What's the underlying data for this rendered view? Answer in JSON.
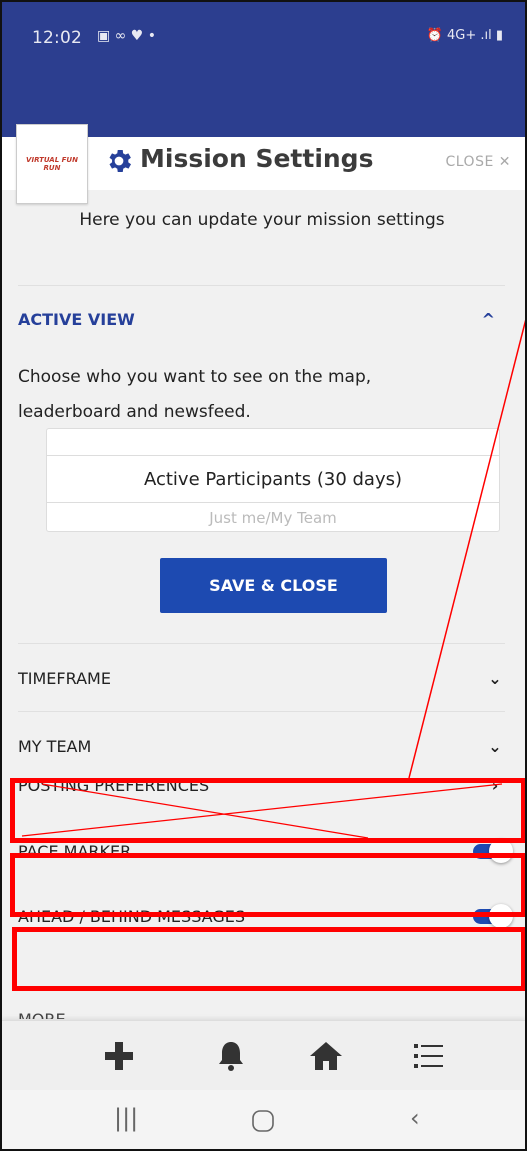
{
  "status_bar": {
    "time": "12:02",
    "left_icons": "▣ ∞ ♥ •",
    "right_icons": "⏰ 4G+ .ıl ▮"
  },
  "logo": {
    "text": "VIRTUAL FUN RUN"
  },
  "modal": {
    "title": "Mission Settings",
    "close_label": "CLOSE ✕",
    "intro": "Here you can update your mission settings"
  },
  "active_view": {
    "title": "ACTIVE VIEW",
    "description": "Choose who you want to see on the map, leaderboard and newsfeed.",
    "options": [
      "Active Participants (30 days)",
      "Just me/My Team"
    ],
    "selected": "Active Participants (30 days)",
    "save_label": "SAVE & CLOSE"
  },
  "sections": {
    "timeframe": "TIMEFRAME",
    "my_team": "MY TEAM",
    "posting_preferences": "POSTING PREFERENCES",
    "pace_marker": "PACE MARKER",
    "ahead_behind": "AHEAD / BEHIND MESSAGES",
    "more": "MORE"
  },
  "toggles": {
    "pace_marker": true,
    "ahead_behind": true
  },
  "colors": {
    "header_bg": "#2c3e8f",
    "accent": "#1d4ab1",
    "annotation": "#ff0000"
  },
  "icons": {
    "bottom_nav": [
      "plus-icon",
      "bell-icon",
      "home-icon",
      "list-icon"
    ],
    "system_nav": [
      "recent-apps-icon",
      "home-circle-icon",
      "back-icon"
    ]
  }
}
